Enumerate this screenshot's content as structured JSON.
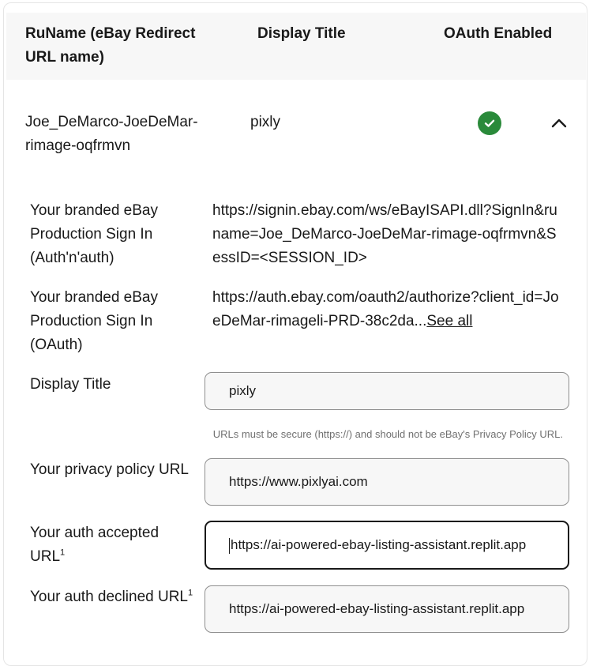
{
  "table": {
    "headers": {
      "runame": "RuName (eBay Redirect URL name)",
      "display_title": "Display Title",
      "oauth_enabled": "OAuth Enabled"
    },
    "row": {
      "runame": "Joe_DeMarco-JoeDeMar-rimage-oqfrmvn",
      "display_title": "pixly",
      "oauth_enabled_icon": "check-circle-icon",
      "expand_icon": "chevron-up-icon"
    }
  },
  "details": {
    "auth_n_auth": {
      "label": "Your branded eBay Production Sign In (Auth'n'auth)",
      "value": "https://signin.ebay.com/ws/eBayISAPI.dll?SignIn&runame=Joe_DeMarco-JoeDeMar-rimage-oqfrmvn&SessID=<SESSION_ID>"
    },
    "oauth": {
      "label": "Your branded eBay Production Sign In (OAuth)",
      "value": "https://auth.ebay.com/oauth2/authorize?client_id=JoeDeMar-rimageli-PRD-38c2da...",
      "see_all": "See all"
    },
    "display_title": {
      "label": "Display Title",
      "value": "pixly"
    },
    "hint": "URLs must be secure (https://) and should not be eBay's Privacy Policy URL.",
    "privacy_url": {
      "label": "Your privacy policy URL",
      "value": "https://www.pixlyai.com"
    },
    "accepted_url": {
      "label": "Your auth accepted URL",
      "sup": "1",
      "value": "https://ai-powered-ebay-listing-assistant.replit.app"
    },
    "declined_url": {
      "label": "Your auth declined URL",
      "sup": "1",
      "value": "https://ai-powered-ebay-listing-assistant.replit.app"
    }
  },
  "colors": {
    "success": "#2a8a3a",
    "header_bg": "#f7f7f7",
    "field_bg": "#f7f7f7"
  }
}
